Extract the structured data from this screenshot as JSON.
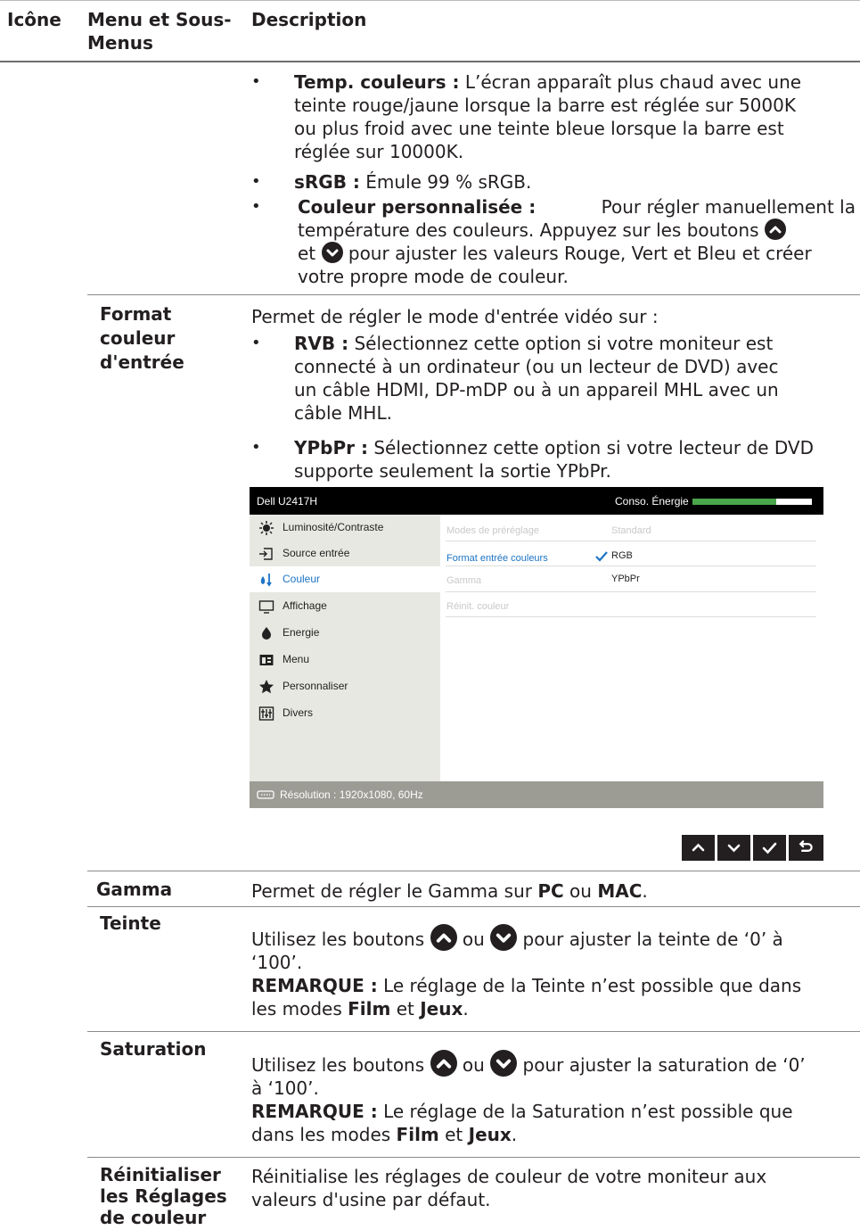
{
  "header": {
    "col_icon": "Icône",
    "col_menu_1": "Menu et Sous-",
    "col_menu_2": "Menus",
    "col_desc": "Description"
  },
  "preset": {
    "temp_label": "Temp. couleurs :",
    "temp_lines": [
      "L’écran apparaît plus chaud avec une",
      "teinte rouge/jaune lorsque la barre est réglée sur 5000K",
      "ou plus froid avec une teinte bleue lorsque la barre est",
      "réglée sur 10000K."
    ],
    "srgb_label": "sRGB :",
    "srgb_text": "Émule 99 % sRGB.",
    "custom_label": "Couleur personnalisée :",
    "custom_l1": "Pour régler manuellement la",
    "custom_l2": "température des couleurs. Appuyez sur les boutons",
    "custom_l3a": "et",
    "custom_l3b": "pour ajuster les valeurs Rouge, Vert et Bleu et créer",
    "custom_l4": "votre propre mode de couleur."
  },
  "input_format": {
    "label_lines": [
      "Format",
      "couleur",
      "d'entrée"
    ],
    "intro": "Permet de régler le mode d'entrée vidéo sur :",
    "rvb_label": "RVB :",
    "rvb_lines": [
      "Sélectionnez cette option si votre moniteur est",
      "connecté à un ordinateur (ou un lecteur de DVD) avec",
      "un câble HDMI, DP-mDP ou à un appareil MHL avec un",
      "câble MHL."
    ],
    "ypbpr_label": "YPbPr :",
    "ypbpr_lines": [
      "Sélectionnez cette option si votre lecteur de DVD",
      "supporte seulement la sortie YPbPr."
    ]
  },
  "osd": {
    "model": "Dell U2417H",
    "energy_label": "Conso. Énergie",
    "energy_level": 0.7,
    "menu": [
      "Luminosité/Contraste",
      "Source entrée",
      "Couleur",
      "Affichage",
      "Energie",
      "Menu",
      "Personnaliser",
      "Divers"
    ],
    "menu_icons": [
      "brightness-icon",
      "input-source-icon",
      "color-icon",
      "display-icon",
      "energy-icon",
      "menu-icon",
      "star-icon",
      "others-icon"
    ],
    "selected": "Couleur",
    "sub": [
      "Modes de préréglage",
      "Format entrée couleurs",
      "Gamma",
      "Réinit. couleur"
    ],
    "preset_value": "Standard",
    "opt_rgb": "RGB",
    "opt_ypbpr": "YPbPr",
    "resolution": "Résolution : 1920x1080, 60Hz",
    "accent": "#4ba54b",
    "sub_selected_color": "#1c74c4"
  },
  "gamma": {
    "label": "Gamma",
    "text_a": "Permet de régler le Gamma sur",
    "pc": "PC",
    "ou": "ou",
    "mac": "MAC",
    "dot": "."
  },
  "hue": {
    "label": "Teinte",
    "l1a": "Utilisez les boutons",
    "l1b": "ou",
    "l1c": "pour ajuster la teinte de ‘0’ à",
    "l2": "‘100’.",
    "note_label": "REMARQUE :",
    "note_a": "Le réglage de la Teinte n’est possible que dans",
    "note_b": "les modes",
    "film": "Film",
    "et": "et",
    "jeux": "Jeux",
    "dot": "."
  },
  "saturation": {
    "label": "Saturation",
    "l1a": "Utilisez les boutons",
    "l1b": "ou",
    "l1c": "pour ajuster la saturation de ‘0’",
    "l2": "à ‘100’.",
    "note_label": "REMARQUE :",
    "note_a1": "Le réglage de la",
    "note_word": "Saturation",
    "note_a2": "n’est possible que",
    "note_b": "dans les modes",
    "film": "Film",
    "et": "et",
    "jeux": "Jeux",
    "dot": "."
  },
  "reset": {
    "label_lines": [
      "Réinitialiser",
      "les Réglages",
      "de couleur"
    ],
    "lines": [
      "Réinitialise les réglages de couleur de votre moniteur aux",
      "valeurs d'usine par défaut."
    ]
  }
}
